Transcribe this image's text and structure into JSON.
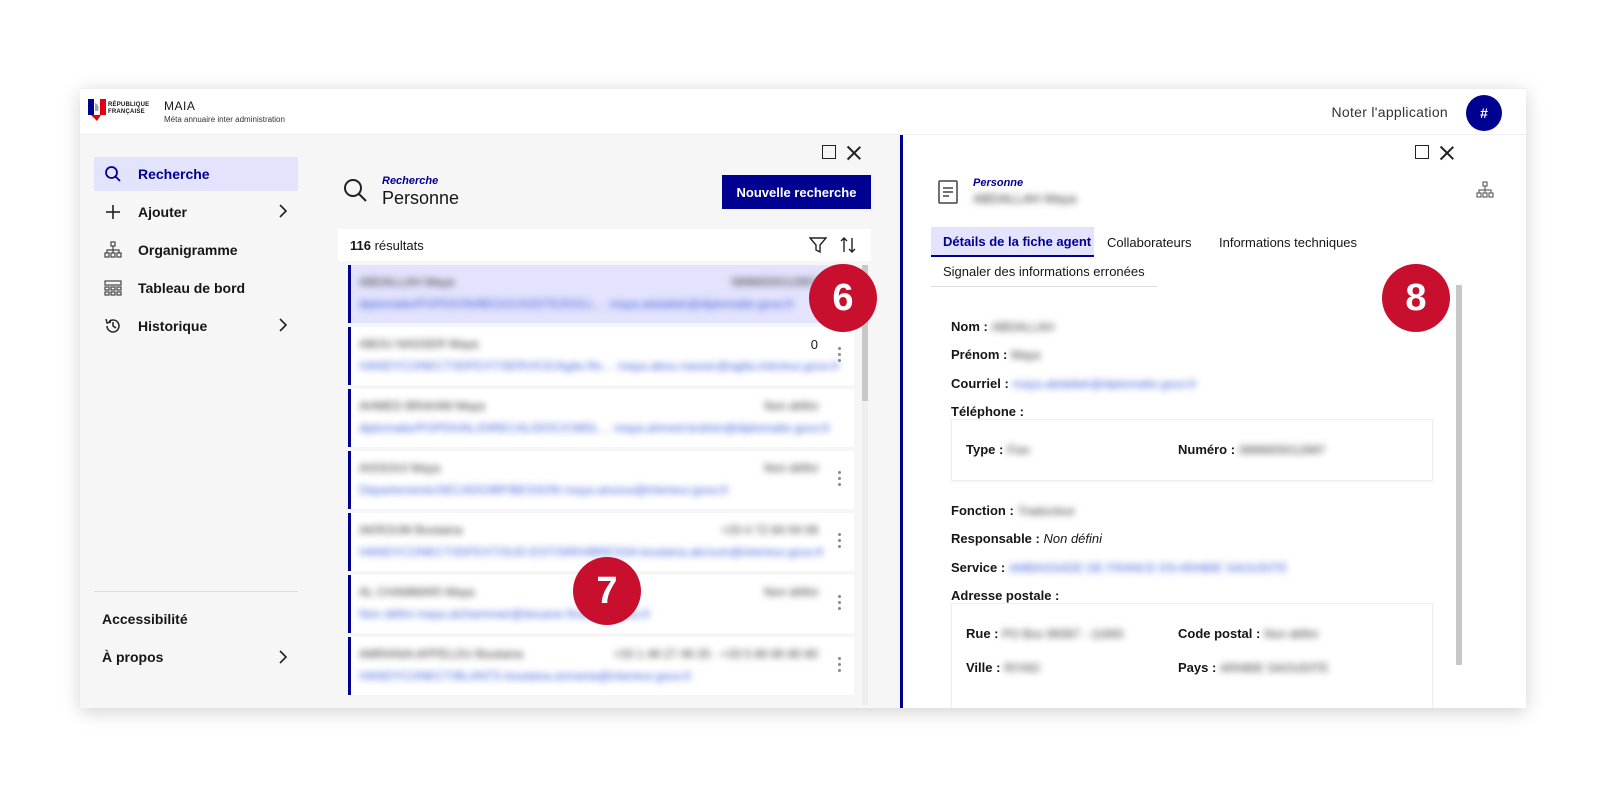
{
  "header": {
    "republic": "RÉPUBLIQUE FRANÇAISE",
    "app_title": "MAIA",
    "app_subtitle": "Méta annuaire inter administration",
    "rate_link": "Noter l'application",
    "avatar": "#"
  },
  "sidebar": {
    "items": [
      {
        "label": "Recherche",
        "icon": "search-icon",
        "active": true
      },
      {
        "label": "Ajouter",
        "icon": "plus-icon"
      },
      {
        "label": "Organigramme",
        "icon": "org-chart-icon"
      },
      {
        "label": "Tableau de bord",
        "icon": "dashboard-icon"
      },
      {
        "label": "Historique",
        "icon": "history-icon"
      }
    ],
    "footer": [
      {
        "label": "Accessibilité"
      },
      {
        "label": "À propos"
      }
    ]
  },
  "search": {
    "overline": "Recherche",
    "title": "Personne",
    "new_button": "Nouvelle recherche",
    "count": "116",
    "count_label": " résultats",
    "rows": [
      {
        "name": "ABDALLAH Maya",
        "phone": "0896655012897",
        "line": "diplomatie/POPDIVIN/BEGOUS/DITE/DOLL… maya.abdallah@diplomatie.gouv.fr"
      },
      {
        "name": "ABOU NASSER Maya",
        "phone": "0",
        "line": "HANDYCONECT/IDFEXT/SERVICE/Agila Re… maya.abou-nasser@agila.interieur.gouv.fr"
      },
      {
        "name": "AHMED BRAHIM Maya",
        "phone": "Non défini",
        "line": "diplomatie/POPDIVAL/DIRECALIDOC/CMDL… maya.ahmed-brahim@diplomatie.gouv.fr"
      },
      {
        "name": "AISSOUI Maya",
        "phone": "Non défini",
        "line": "Départements/SECADO/BP/BESSON maya.aissoui@interieur.gouv.fr"
      },
      {
        "name": "AKROUM Boutaina",
        "phone": "+33 4 72 84 04 08",
        "line": "HANDYCONECT/IDFEXT/SUD-EST/SIRH/BRESSA boutaina.akroum@interieur.gouv.fr"
      },
      {
        "name": "AL CHAMMARI Maya",
        "phone": "Non défini",
        "line": "Non défini maya.alchammari@douane.finances.gouv.fr"
      },
      {
        "name": "AMRANIA APPELOU Boutaina",
        "phone": "+33 1 49 27 49 25 - +33 5 80 80 80 80",
        "line": "HANDYCONECT/BLANTS boutaina.amrania@interieur.gouv.fr"
      }
    ]
  },
  "detail": {
    "overline": "Personne",
    "name_blur": "ABDALLAH Maya",
    "tabs": [
      {
        "label": "Détails de la fiche agent",
        "active": true
      },
      {
        "label": "Collaborateurs"
      },
      {
        "label": "Informations techniques"
      },
      {
        "label": "Signaler des informations erronées"
      }
    ],
    "fields": {
      "nom_label": "Nom :",
      "nom": "ABDALLAH",
      "prenom_label": "Prénom :",
      "prenom": "Maya",
      "courriel_label": "Courriel :",
      "courriel": "maya.abdallah@diplomatie.gouv.fr",
      "telephone_label": "Téléphone :",
      "type_label": "Type :",
      "type": "Fixe",
      "numero_label": "Numéro :",
      "numero": "0896655012897",
      "fonction_label": "Fonction :",
      "fonction": "Traducteur",
      "responsable_label": "Responsable :",
      "responsable": "Non défini",
      "service_label": "Service :",
      "service": "AMBASSADE DE FRANCE EN ARABIE SAOUDITE",
      "adresse_label": "Adresse postale :",
      "rue_label": "Rue :",
      "rue": "PO Box 99367 - 11693",
      "code_postal_label": "Code postal :",
      "code_postal": "Non défini",
      "ville_label": "Ville :",
      "ville": "RIYAD",
      "pays_label": "Pays :",
      "pays": "ARABIE SAOUDITE"
    }
  },
  "callouts": [
    "6",
    "7",
    "8"
  ],
  "colors": {
    "primary": "#000091",
    "callout": "#c8102e",
    "selected": "#e3e3fd"
  }
}
